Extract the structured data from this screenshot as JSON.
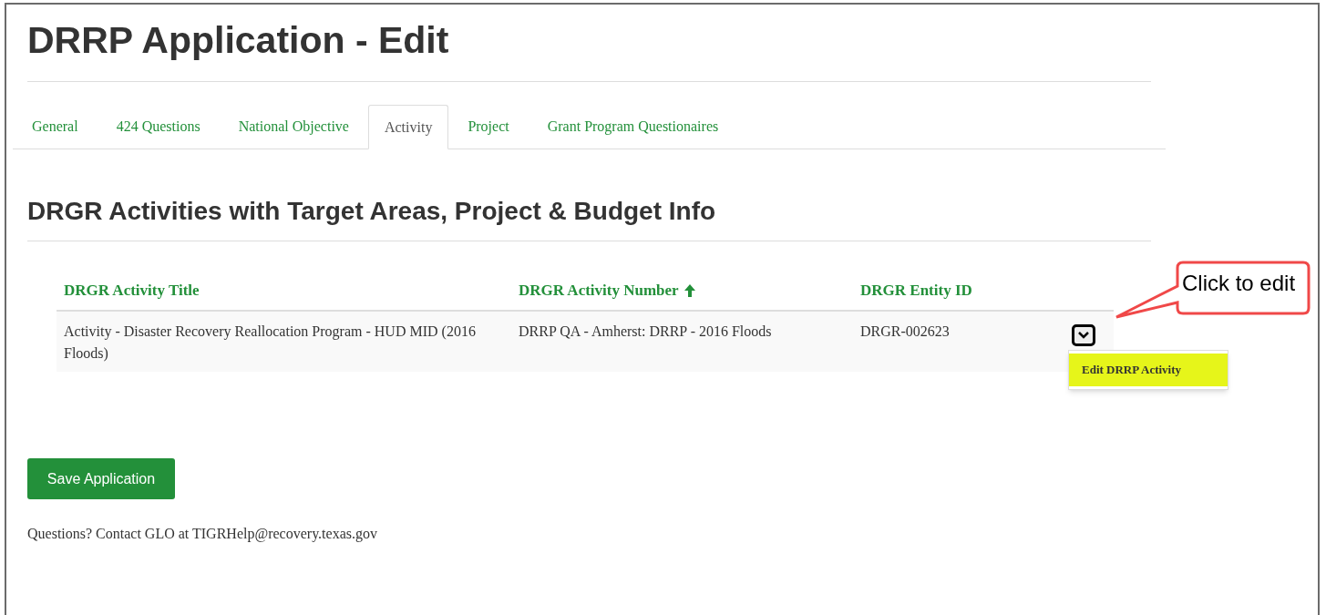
{
  "page_title": "DRRP Application - Edit",
  "tabs": [
    {
      "label": "General",
      "selected": false
    },
    {
      "label": "424 Questions",
      "selected": false
    },
    {
      "label": "National Objective",
      "selected": false
    },
    {
      "label": "Activity",
      "selected": true
    },
    {
      "label": "Project",
      "selected": false
    },
    {
      "label": "Grant Program Questionaires",
      "selected": false
    }
  ],
  "section_title": "DRGR Activities with Target Areas, Project & Budget Info",
  "table": {
    "columns": [
      {
        "label": "DRGR Activity Title",
        "sorted": false
      },
      {
        "label": "DRGR Activity Number",
        "sorted": true
      },
      {
        "label": "DRGR Entity ID",
        "sorted": false
      }
    ],
    "rows": [
      {
        "cells": [
          "Activity - Disaster Recovery Reallocation Program - HUD MID (2016 Floods)",
          "DRRP QA - Amherst: DRRP - 2016 Floods",
          "DRGR-002623"
        ],
        "menu_open": true,
        "menu_items": [
          {
            "label": "Edit DRRP Activity",
            "highlighted": true
          }
        ]
      }
    ]
  },
  "callout": "Click to edit",
  "save_button": "Save Application",
  "footer": "Questions? Contact GLO at TIGRHelp@recovery.texas.gov"
}
